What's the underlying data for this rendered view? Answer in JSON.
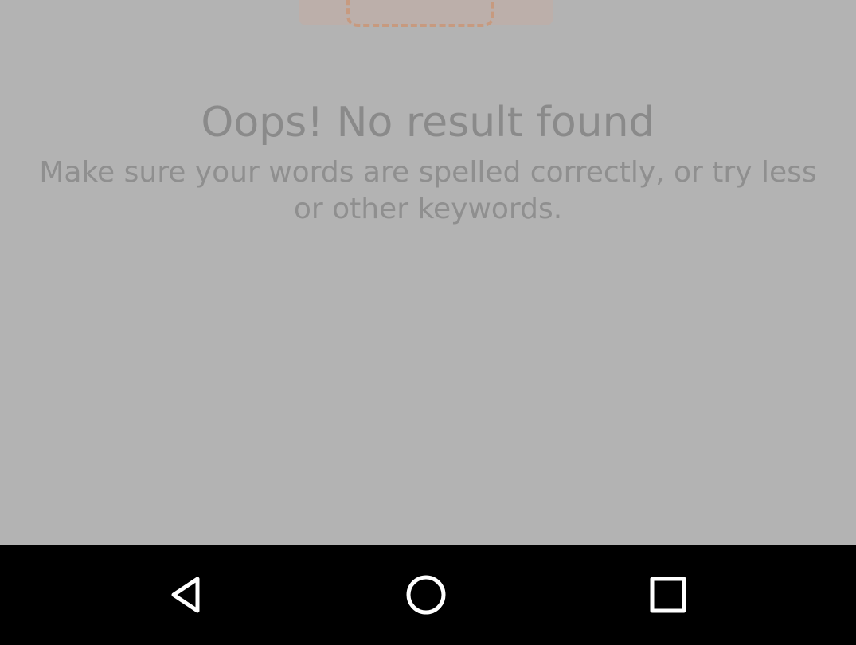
{
  "empty_state": {
    "illustration_icon": "empty-search-illustration",
    "title": "Oops! No result found",
    "message": "Make sure your words are spelled correctly, or try less or other keywords."
  },
  "navbar": {
    "buttons": [
      {
        "icon": "back-triangle-icon"
      },
      {
        "icon": "home-circle-icon"
      },
      {
        "icon": "recents-square-icon"
      }
    ]
  },
  "colors": {
    "overlay_background": "#b3b3b3",
    "navbar_background": "#000000",
    "nav_icon": "#ffffff",
    "illustration_accent": "#c79a7f"
  }
}
